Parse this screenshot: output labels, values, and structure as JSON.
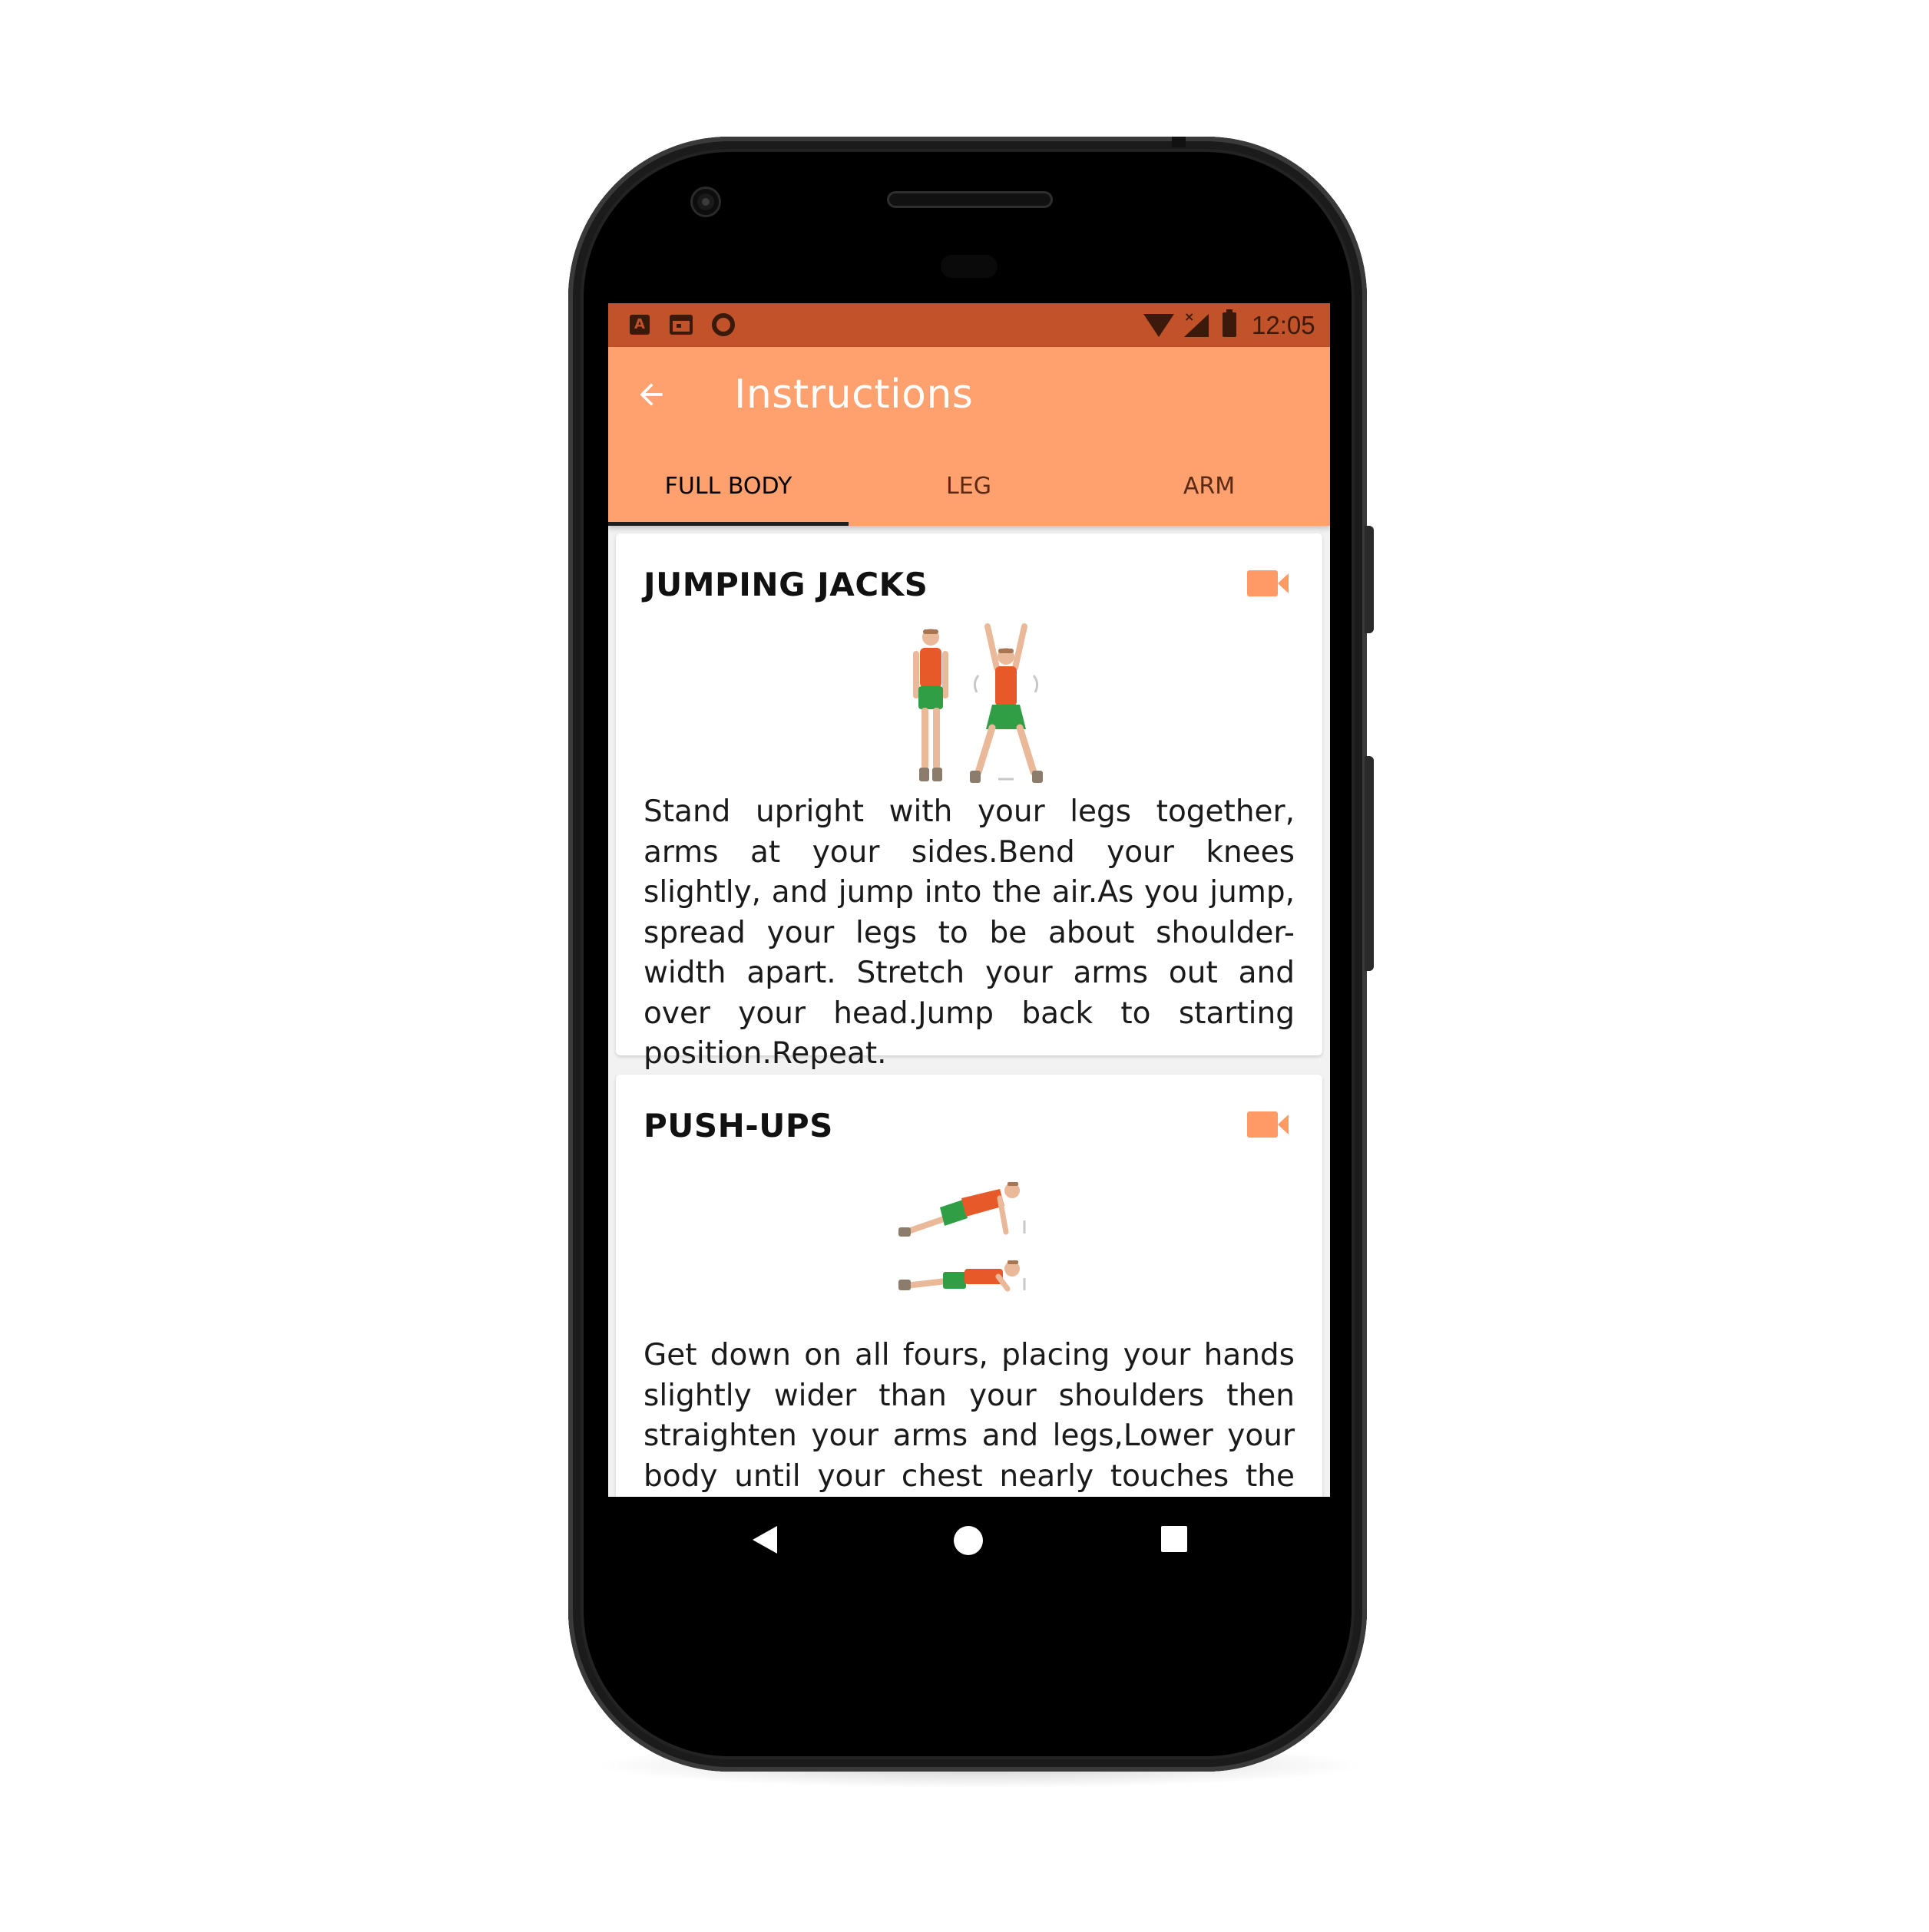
{
  "status_bar": {
    "time": "12:05",
    "left_icons": [
      "a-notification-icon",
      "calendar-icon",
      "circle-icon"
    ],
    "right_icons": [
      "wifi-icon",
      "signal-icon",
      "battery-icon"
    ]
  },
  "app_bar": {
    "title": "Instructions",
    "back_icon": "arrow-left-icon"
  },
  "tabs": [
    {
      "label": "FULL BODY",
      "active": true
    },
    {
      "label": "LEG",
      "active": false
    },
    {
      "label": "ARM",
      "active": false
    }
  ],
  "cards": [
    {
      "title": "JUMPING JACKS",
      "icon": "video-camera-icon",
      "description": "Stand upright with your legs together, arms at your sides.Bend your knees slightly, and jump into the air.As you jump, spread your legs to be about shoulder-width apart. Stretch your arms out and over your head.Jump back to starting position.Repeat."
    },
    {
      "title": "PUSH-UPS",
      "icon": "video-camera-icon",
      "description": "Get down on all fours, placing your hands slightly wider than your shoulders then straighten your arms and legs,Lower your body until your chest nearly touches the floor.Pause, then push yourself back up. Repeat."
    }
  ],
  "nav_bar": {
    "icons": [
      "nav-back-icon",
      "nav-home-icon",
      "nav-recents-icon"
    ]
  },
  "colors": {
    "status_bar": "#c1522a",
    "app_bar": "#ffa06f",
    "accent_icon": "#ff9a66",
    "shirt": "#e8592a",
    "shorts": "#2f9e45"
  }
}
